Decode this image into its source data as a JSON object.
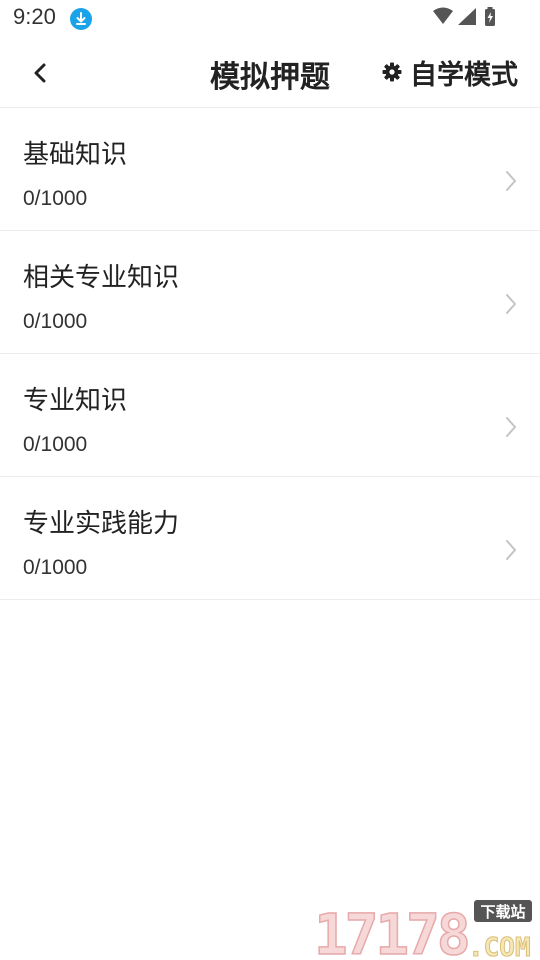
{
  "status_bar": {
    "time": "9:20",
    "icons": [
      "download-icon",
      "wifi-icon",
      "signal-icon",
      "battery-charging-icon"
    ]
  },
  "header": {
    "back_icon": "chevron-left-icon",
    "title": "模拟押题",
    "mode_icon": "gear-icon",
    "mode_label": "自学模式"
  },
  "items": [
    {
      "title": "基础知识",
      "progress": "0/1000"
    },
    {
      "title": "相关专业知识",
      "progress": "0/1000"
    },
    {
      "title": "专业知识",
      "progress": "0/1000"
    },
    {
      "title": "专业实践能力",
      "progress": "0/1000"
    }
  ],
  "watermark": {
    "number": "17178",
    "suffix": ".COM",
    "badge": "下载站"
  },
  "colors": {
    "accent": "#1aa3e8",
    "divider": "#ececec",
    "chevron": "#c4c4c4"
  }
}
